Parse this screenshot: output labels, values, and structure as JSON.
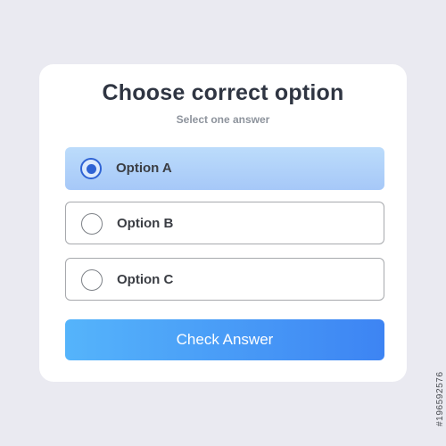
{
  "quiz": {
    "title": "Choose correct option",
    "subtitle": "Select one answer",
    "options": [
      {
        "label": "Option A",
        "selected": true
      },
      {
        "label": "Option B",
        "selected": false
      },
      {
        "label": "Option C",
        "selected": false
      }
    ],
    "submit_label": "Check Answer"
  },
  "watermark": {
    "id_text": "#196592576"
  },
  "colors": {
    "background": "#eaeaf1",
    "card": "#ffffff",
    "title": "#2f3542",
    "selected_option": "#b3d3fa",
    "radio_accent": "#2f63d4",
    "button_gradient_start": "#55b4fb",
    "button_gradient_end": "#3d84f3"
  }
}
